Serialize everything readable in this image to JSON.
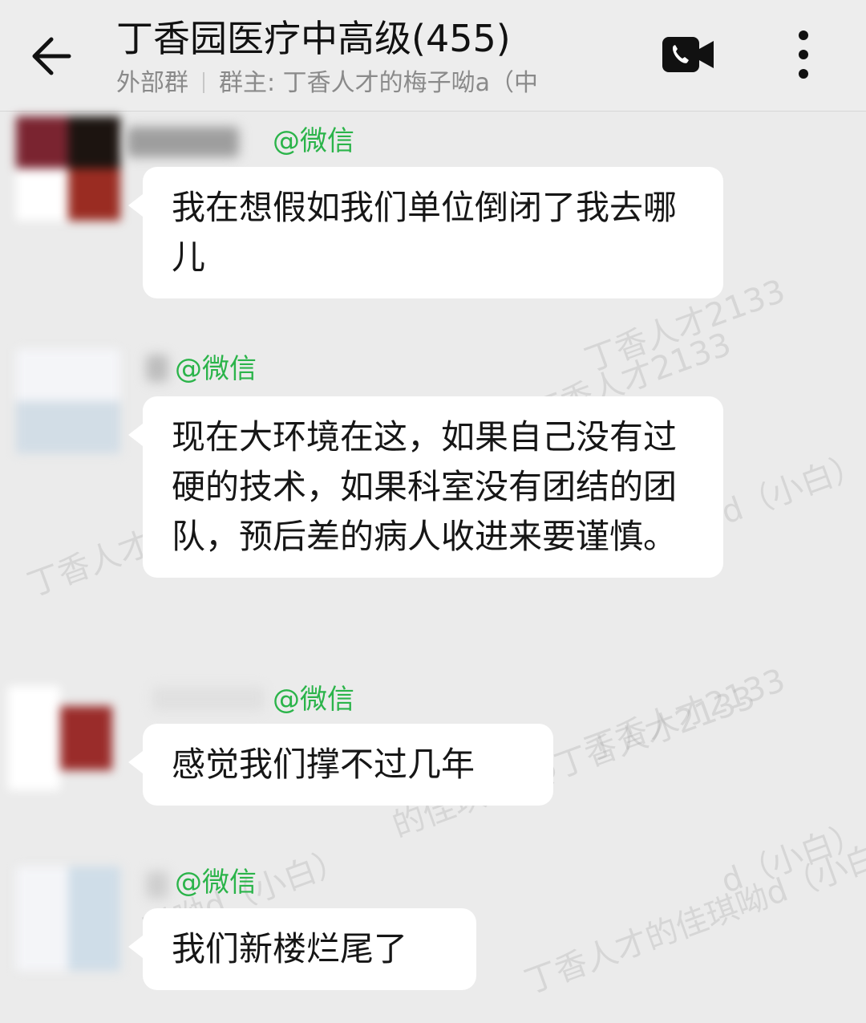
{
  "header": {
    "title": "丁香园医疗中高级(455)",
    "subtitle_left": "外部群",
    "subtitle_right": "群主: 丁香人才的梅子呦a（中",
    "back_icon": "arrow-left-icon",
    "call_icon": "video-call-icon",
    "more_icon": "more-vertical-icon"
  },
  "messages": [
    {
      "sender_suffix": "@微信",
      "text": "我在想假如我们单位倒闭了我去哪儿"
    },
    {
      "sender_suffix": "@微信",
      "text": "现在大环境在这，如果自己没有过硬的技术，如果科室没有团结的团队，预后差的病人收进来要谨慎。"
    },
    {
      "sender_suffix": "@微信",
      "text": "感觉我们撑不过几年"
    },
    {
      "sender_suffix": "@微信",
      "text": "我们新楼烂尾了"
    }
  ],
  "watermarks": {
    "a": "丁香人才2133",
    "b": "的佳琪呦)@丁香人才2133",
    "c": "丁香人才的",
    "d": "d（小白）",
    "e": "琪呦d（小白）",
    "f": "丁香人才的佳琪呦d（小白）"
  },
  "colors": {
    "background": "#ebebeb",
    "header": "#ededed",
    "bubble": "#ffffff",
    "sender": "#2bb44a"
  }
}
